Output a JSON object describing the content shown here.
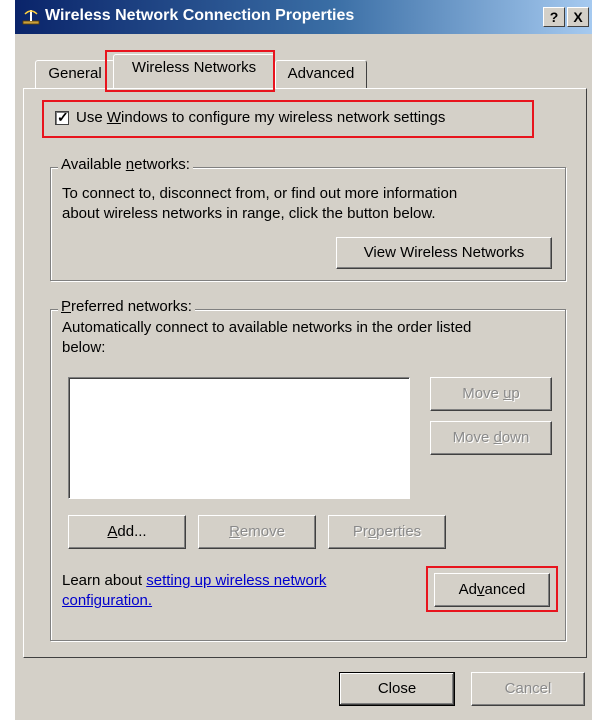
{
  "window": {
    "title": "Wireless Network Connection Properties",
    "help_button": "?",
    "close_button": "X"
  },
  "tabs": [
    {
      "label": "General",
      "active": false
    },
    {
      "label": "Wireless Networks",
      "active": true
    },
    {
      "label": "Advanced",
      "active": false
    }
  ],
  "use_windows": {
    "checked": true,
    "label_pre": "Use ",
    "label_mnemonic": "W",
    "label_post": "indows to configure my wireless network settings"
  },
  "available": {
    "label_pre": "Available ",
    "label_mnemonic": "n",
    "label_post": "etworks:",
    "line1": "To connect to, disconnect from, or find out more information",
    "line2": "about wireless networks in range, click the button below.",
    "view_button": "View Wireless Networks"
  },
  "preferred": {
    "label_mnemonic": "P",
    "label_post": "referred networks:",
    "line1": "Automatically connect to available networks in the order listed",
    "line2": "below:",
    "move_up_pre": "Move ",
    "move_up_mnemonic": "u",
    "move_up_post": "p",
    "move_down_pre": "Move ",
    "move_down_mnemonic": "d",
    "move_down_post": "own",
    "add_mnemonic": "A",
    "add_post": "dd...",
    "remove_mnemonic": "R",
    "remove_post": "emove",
    "properties_pre": "Pr",
    "properties_mnemonic": "o",
    "properties_post": "perties"
  },
  "learn": {
    "prefix": "Learn about ",
    "link_line1": "setting up wireless network",
    "link_line2": "configuration."
  },
  "advanced_button": {
    "pre": "Ad",
    "mnemonic": "v",
    "post": "anced"
  },
  "footer": {
    "close": "Close",
    "cancel": "Cancel"
  },
  "colors": {
    "highlight": "#e8141e",
    "dialog_face": "#d4d0c8",
    "title_bar": "#0a246a"
  }
}
